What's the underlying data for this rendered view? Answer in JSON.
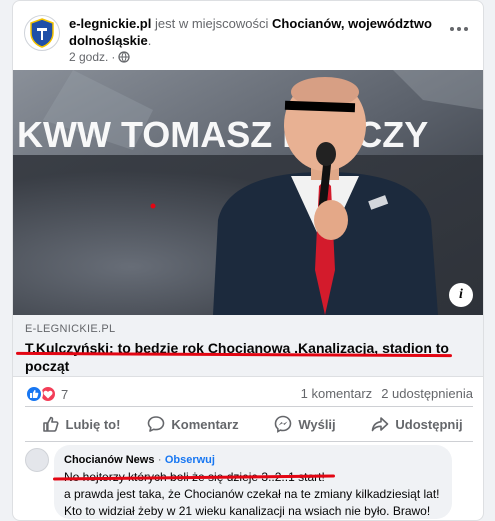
{
  "post": {
    "page_name": "e-legnickie.pl",
    "location_prefix": "jest w miejscowości",
    "location": "Chocianów, województwo dolnośląskie",
    "location_suffix": ".",
    "time": "2 godz.",
    "time_separator": "·"
  },
  "icons": {
    "page_logo": "shield-logo-icon",
    "privacy": "globe-icon",
    "more": "more-options-icon",
    "info": "info-icon",
    "like_reaction": "like-reaction-icon",
    "love_reaction": "love-reaction-icon",
    "like_action": "thumbs-up-icon",
    "comment_action": "comment-icon",
    "send_action": "messenger-icon",
    "share_action": "share-icon"
  },
  "image": {
    "banner_text": "KWW TOMASZ KULCZY"
  },
  "link_preview": {
    "domain": "E-LEGNICKIE.PL",
    "title": "T.Kulczyński: to bedzie rok Chocianowa .Kanalizacja, stadion to począt"
  },
  "stats": {
    "reaction_count": "7",
    "comments": "1 komentarz",
    "shares": "2 udostępnienia"
  },
  "actions": {
    "like": "Lubię to!",
    "comment": "Komentarz",
    "send": "Wyślij",
    "share": "Udostępnij"
  },
  "comment": {
    "author": "Chocianów News",
    "separator": "·",
    "follow": "Obserwuj",
    "line1": "No hejterzy których boli że się dzieje 3..2..1 start!",
    "line2": "a prawda jest taka, że Chocianów czekał na te zmiany kilkadziesiąt lat!",
    "line3": "Kto to widział żeby w 21 wieku kanalizacji na wsiach nie było. Brawo!"
  },
  "colors": {
    "accent": "#1877f2",
    "love": "#f33e58",
    "markup_red": "#e30613",
    "secondary_text": "#65676b"
  }
}
